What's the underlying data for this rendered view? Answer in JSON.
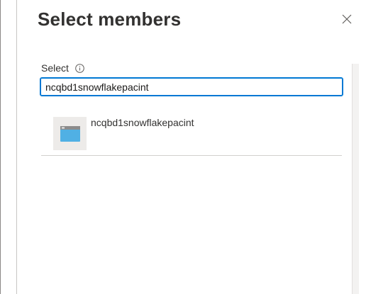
{
  "panel": {
    "title": "Select members",
    "close_icon": "close-icon"
  },
  "search": {
    "label": "Select",
    "info_icon": "info-icon",
    "value": "ncqbd1snowflakepacint"
  },
  "results": [
    {
      "name": "ncqbd1snowflakepacint",
      "icon": "app-registration-icon"
    }
  ],
  "colors": {
    "accent": "#0078d4",
    "thumb_background": "#edebe9",
    "app_icon_blue": "#50b0e4"
  }
}
